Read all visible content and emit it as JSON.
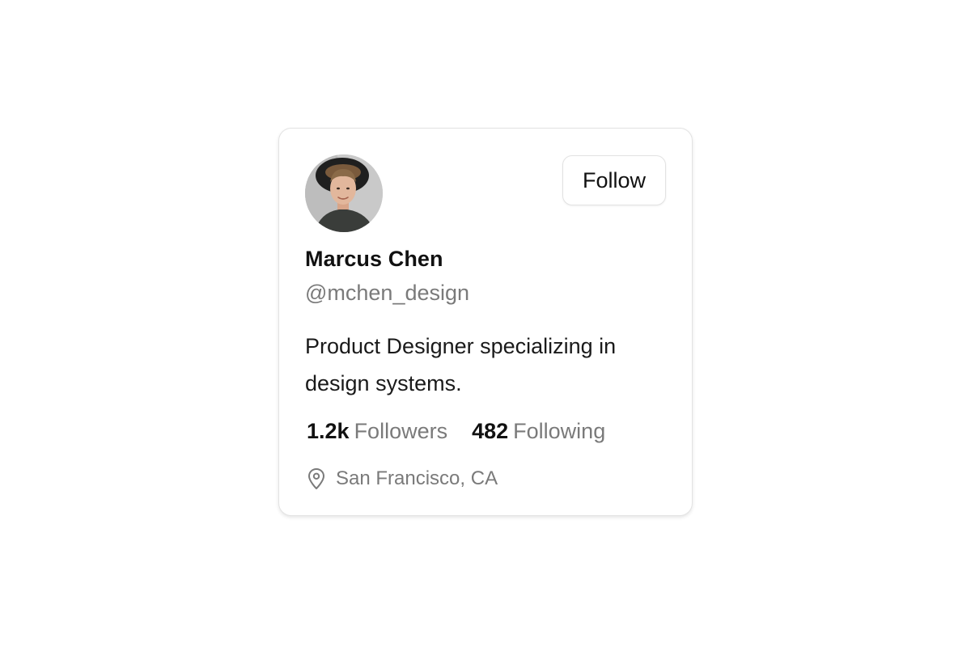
{
  "profile": {
    "name": "Marcus Chen",
    "handle": "@mchen_design",
    "bio": "Product Designer specializing in design systems.",
    "avatar_icon": "user-photo",
    "follow_label": "Follow",
    "stats": {
      "followers_count": "1.2k",
      "followers_label": "Followers",
      "following_count": "482",
      "following_label": "Following"
    },
    "location": {
      "icon": "map-pin-icon",
      "text": "San Francisco, CA"
    }
  },
  "colors": {
    "text_primary": "#111111",
    "text_secondary": "#7a7a7a",
    "card_border": "#e3e3e3"
  }
}
